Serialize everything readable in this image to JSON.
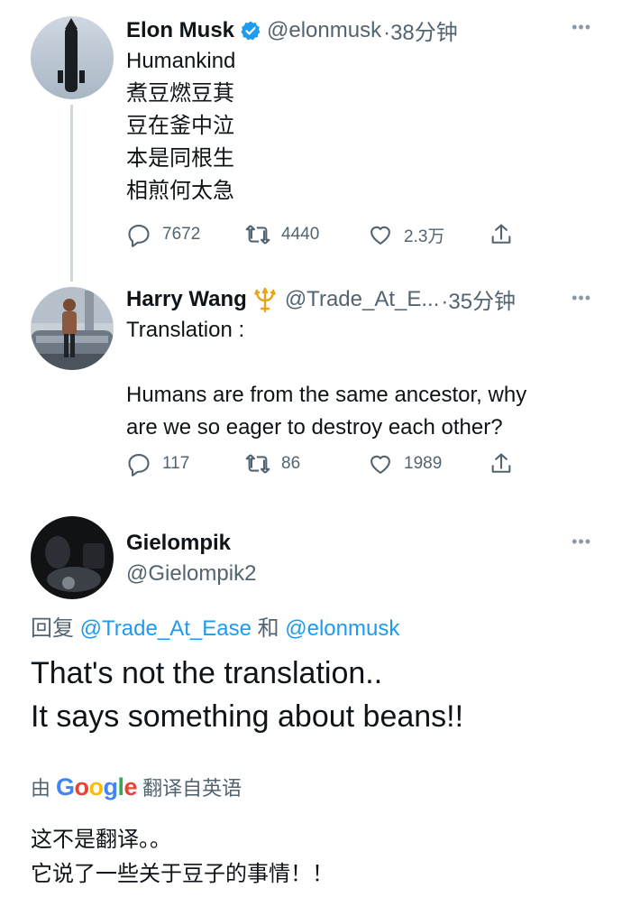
{
  "tweet1": {
    "display_name": "Elon Musk",
    "handle": "@elonmusk",
    "time": "·38分钟",
    "lines": [
      "Humankind",
      "煮豆燃豆萁",
      "豆在釜中泣",
      "本是同根生",
      "相煎何太急"
    ],
    "replies": "7672",
    "retweets": "4440",
    "likes": "2.3万"
  },
  "tweet2": {
    "display_name": "Harry Wang",
    "handle": "@Trade_At_E...",
    "time": "·35分钟",
    "lines": [
      "Translation :",
      "",
      "Humans are from the same ancestor, why",
      "are we so eager to destroy each other?"
    ],
    "replies": "117",
    "retweets": "86",
    "likes": "1989"
  },
  "tweet3": {
    "display_name": "Gielompik",
    "handle": "@Gielompik2",
    "reply_prefix": "回复",
    "reply_user1": "@Trade_At_Ease",
    "reply_and": "和",
    "reply_user2": "@elonmusk",
    "lines": [
      "That's not the translation..",
      "It says something about beans!!"
    ],
    "translated_by_prefix": "由",
    "translated_by_brand": "Google",
    "translated_by_suffix": "翻译自英语",
    "translated_lines": [
      "这不是翻译。。",
      "它说了一些关于豆子的事情！！"
    ]
  },
  "icons": {
    "reply": "reply-icon",
    "retweet": "retweet-icon",
    "like": "heart-icon",
    "share": "share-icon",
    "more": "more-icon",
    "verified": "verified-badge-icon",
    "trident": "trident-icon"
  },
  "colors": {
    "link": "#1d9bf0",
    "secondary": "#536471",
    "verified": "#1d9bf0",
    "trident": "#e8a317"
  }
}
